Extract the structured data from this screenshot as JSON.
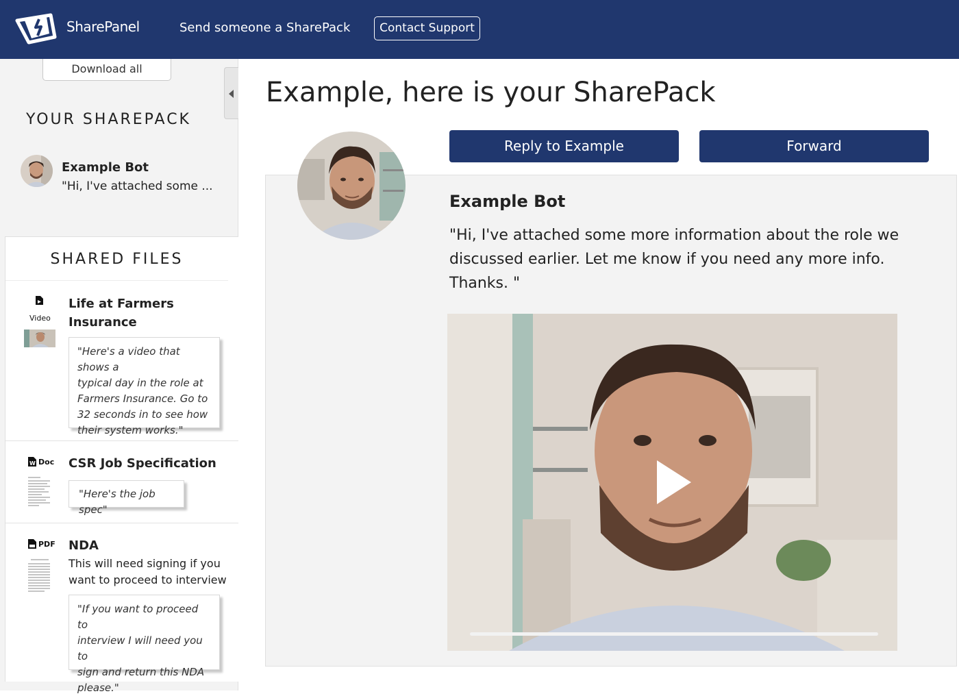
{
  "header": {
    "logo_text": "SharePanel",
    "nav_link": "Send someone a SharePack",
    "support_button": "Contact Support"
  },
  "sidebar": {
    "download_all": "Download all",
    "your_sharepack_title": "YOUR SHAREPACK",
    "sender_name": "Example Bot",
    "sender_snippet": "\"Hi, I've attached some ...",
    "shared_files_title": "SHARED FILES",
    "files": [
      {
        "type": "Video",
        "name_line1": "Life at Farmers",
        "name_line2": "Insurance",
        "quote_lines": [
          "\"Here's a video that shows a",
          "typical day in the role at",
          "Farmers Insurance. Go to",
          "32 seconds in to see how",
          "their system works.\""
        ]
      },
      {
        "type": "Doc",
        "name": "CSR Job Specification",
        "quote": "\"Here's the job spec\""
      },
      {
        "type": "PDF",
        "name": "NDA",
        "desc_line1": "This will need signing if you",
        "desc_line2": "want to proceed to interview",
        "quote_lines": [
          "\"If you want to proceed to",
          "interview I will need you to",
          "sign and return this NDA",
          "please.\""
        ]
      }
    ]
  },
  "main": {
    "title": "Example, here is your SharePack",
    "reply_button": "Reply to Example",
    "forward_button": "Forward",
    "message_sender": "Example Bot",
    "message_lines": [
      "\"Hi, I've attached some more information about the role we",
      "discussed earlier. Let me know if you need any more info.",
      "Thanks. \""
    ]
  },
  "colors": {
    "brand_navy": "#20376e",
    "panel_gray": "#f3f3f3"
  }
}
